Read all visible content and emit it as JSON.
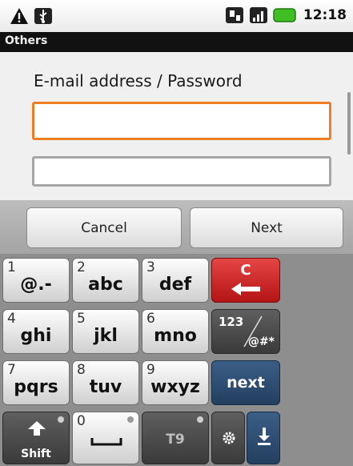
{
  "status_bar": {
    "time": "12:18",
    "left_icons": [
      "warning-icon",
      "usb-icon"
    ],
    "right_icons": [
      "sim-icon",
      "signal-icon",
      "battery-icon"
    ],
    "battery_color": "#3fbf23"
  },
  "title_bar": {
    "title": "Others"
  },
  "form": {
    "label": "E-mail address / Password",
    "email_value": "",
    "password_value": "",
    "focus_color": "#ef7d22"
  },
  "actions": {
    "cancel": "Cancel",
    "next": "Next"
  },
  "keyboard": {
    "keys": [
      {
        "num": "1",
        "chars": "@.-"
      },
      {
        "num": "2",
        "chars": "abc"
      },
      {
        "num": "3",
        "chars": "def"
      },
      {
        "num": "4",
        "chars": "ghi"
      },
      {
        "num": "5",
        "chars": "jkl"
      },
      {
        "num": "6",
        "chars": "mno"
      },
      {
        "num": "7",
        "chars": "pqrs"
      },
      {
        "num": "8",
        "chars": "tuv"
      },
      {
        "num": "9",
        "chars": "wxyz"
      },
      {
        "num": "0",
        "chars": ""
      }
    ],
    "clear_key": "C",
    "symbol_key_top": "123",
    "symbol_key_bottom": "@#*",
    "next_key": "next",
    "shift_label": "Shift",
    "t9_label": "T9",
    "special_icons": [
      "backspace-arrow-icon",
      "shift-arrow-icon",
      "space-icon",
      "gear-icon",
      "download-arrow-icon"
    ]
  }
}
